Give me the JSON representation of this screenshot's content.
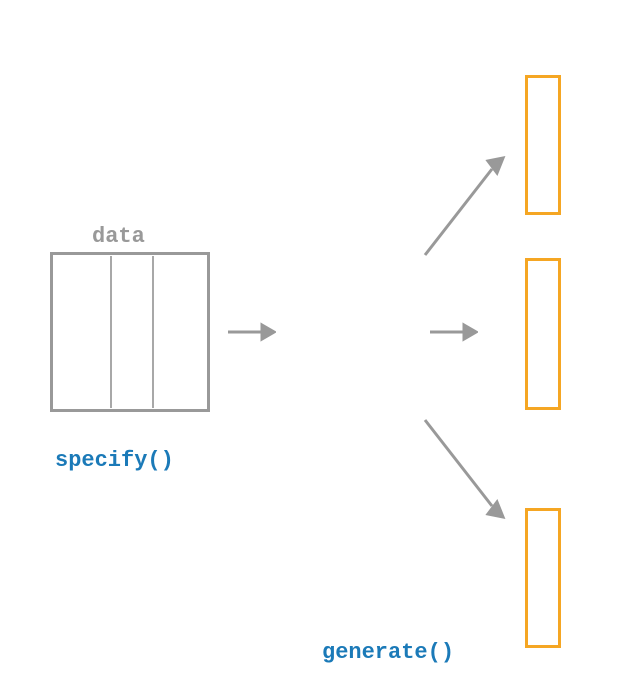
{
  "labels": {
    "data": "data",
    "specify": "specify()",
    "generate": "generate()"
  },
  "colors": {
    "gray": "#999999",
    "blue": "#1b7ab8",
    "orange": "#f5a623"
  },
  "diagram": {
    "description": "data specification to generation flow",
    "left_node": "data box with highlighted column",
    "right_nodes": 3,
    "arrows": 4
  }
}
